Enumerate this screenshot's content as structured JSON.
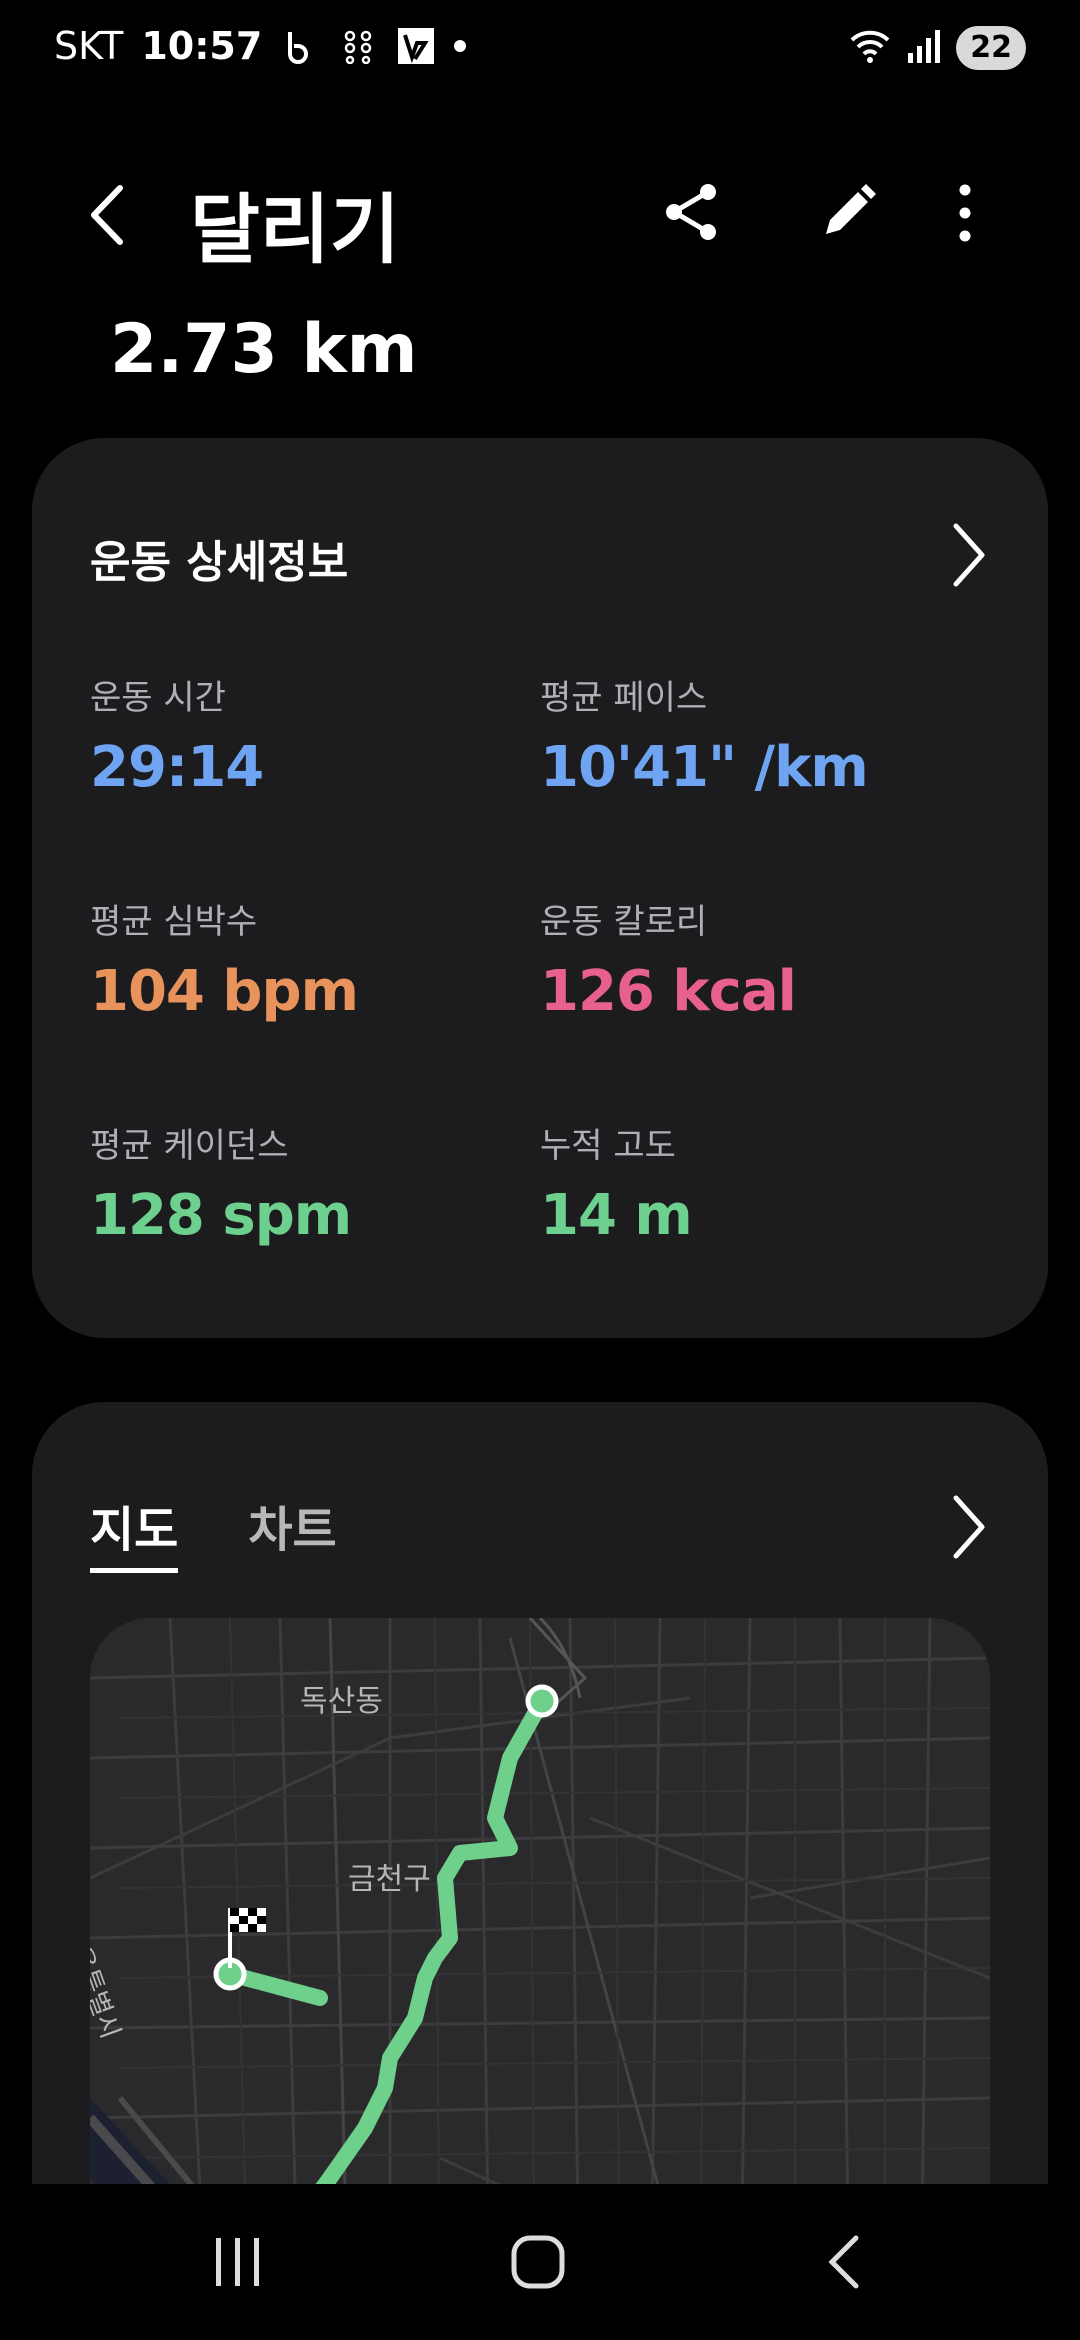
{
  "status_bar": {
    "carrier": "SKT",
    "time": "10:57",
    "battery": "22"
  },
  "app_bar": {
    "title": "달리기"
  },
  "summary": {
    "distance": "2.73 km"
  },
  "details": {
    "title": "운동 상세정보",
    "stats": [
      {
        "label": "운동 시간",
        "value": "29:14",
        "color": "#6fa4f2"
      },
      {
        "label": "평균 페이스",
        "value": "10'41\" /km",
        "color": "#6fa4f2"
      },
      {
        "label": "평균 심박수",
        "value": "104 bpm",
        "color": "#e8935c"
      },
      {
        "label": "운동 칼로리",
        "value": "126 kcal",
        "color": "#e8608f"
      },
      {
        "label": "평균 케이던스",
        "value": "128 spm",
        "color": "#6dd08e"
      },
      {
        "label": "누적 고도",
        "value": "14 m",
        "color": "#6dd08e"
      }
    ]
  },
  "map_card": {
    "tabs": [
      "지도",
      "차트"
    ],
    "active_tab": "지도",
    "map_labels": [
      "독산동",
      "금천구",
      "서울특별시"
    ],
    "route_color": "#6fd08c"
  }
}
